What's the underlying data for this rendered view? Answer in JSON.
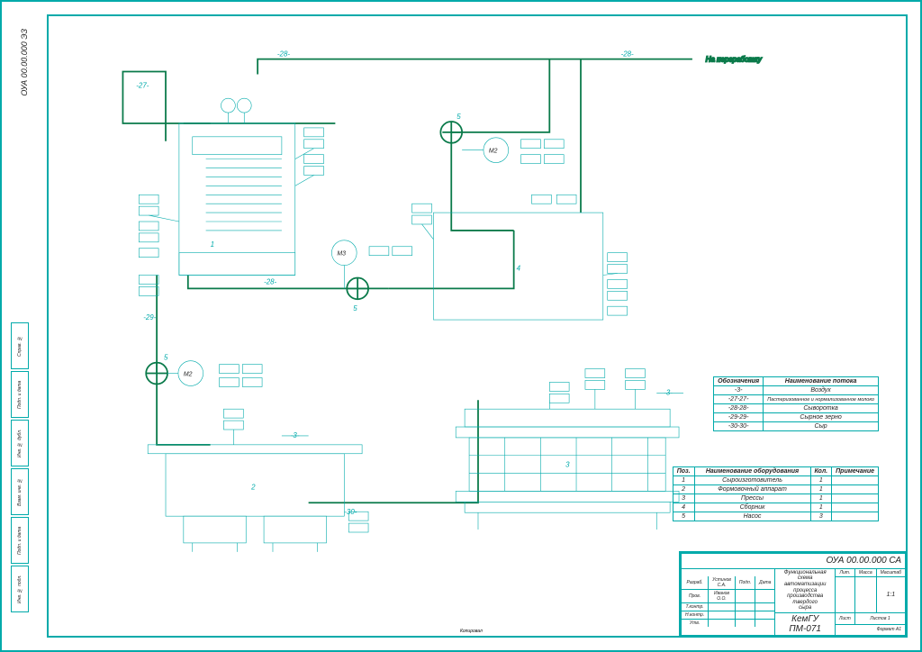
{
  "doc_code_top": "ОУА 00.00.000 ЭЗ",
  "top_right_label": "На переработку",
  "equipment_numbers": [
    "1",
    "2",
    "3",
    "4",
    "5",
    "5",
    "5"
  ],
  "motor_labels": [
    "М2",
    "М3",
    "М2"
  ],
  "flow_labels": [
    "-27-",
    "-28-",
    "-28-",
    "-28-",
    "-29-",
    "-30-",
    "-3-",
    "-3-"
  ],
  "flows_table": {
    "h1": "Обозначения",
    "h2": "Наименование потока",
    "rows": [
      [
        "-3-",
        "Воздух"
      ],
      [
        "-27-27-",
        "Пастеризованное и нормализованное молоко"
      ],
      [
        "-28-28-",
        "Сыворотка"
      ],
      [
        "-29-29-",
        "Сырное зерно"
      ],
      [
        "-30-30-",
        "Сыр"
      ]
    ]
  },
  "equip_table": {
    "h1": "Поз.",
    "h2": "Наименование оборудования",
    "h3": "Кол.",
    "h4": "Примечание",
    "rows": [
      [
        "1",
        "Сыроизготовитель",
        "1",
        ""
      ],
      [
        "2",
        "Формовочный аппарат",
        "1",
        ""
      ],
      [
        "3",
        "Прессы",
        "1",
        ""
      ],
      [
        "4",
        "Сборник",
        "1",
        ""
      ],
      [
        "5",
        "Насос",
        "3",
        ""
      ]
    ]
  },
  "title_block": {
    "code": "ОУА 00.00.000 СА",
    "title_l1": "Функциональная схема",
    "title_l2": "автоматизации процесса",
    "title_l3": "производства твердого",
    "title_l4": "сыра",
    "org": "КемГУ ПМ-071",
    "scale": "1:1",
    "sheet": "1",
    "format": "А1",
    "role1": "Разраб.",
    "name1": "Устинов С.А.",
    "role2": "Пров.",
    "name2": "Иванов О.О.",
    "role3": "Т.контр.",
    "role4": "Н.контр.",
    "role5": "Утв.",
    "head_lit": "Лит.",
    "head_mass": "Масса",
    "head_scale": "Масштаб",
    "head_list": "Лист",
    "head_lists": "Листов",
    "footer": "Копировал"
  },
  "side_tabs": [
    "Справ. №",
    "Подп. и дата",
    "Инв. № дубл.",
    "Взам. инв. №",
    "Подп. и дата",
    "Инв. № подл."
  ]
}
